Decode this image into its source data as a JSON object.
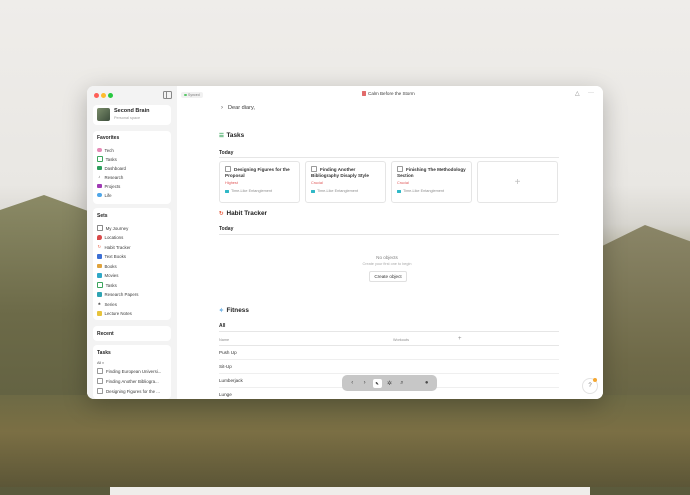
{
  "space": {
    "name": "Second Brain",
    "subtitle": "Personal space"
  },
  "favorites": {
    "title": "Favorites",
    "items": [
      {
        "label": "Tech",
        "icon": "tech-icon",
        "color": "#e58ab6"
      },
      {
        "label": "Tasks",
        "icon": "tasks-icon",
        "color": "#3ba55c"
      },
      {
        "label": "Dashboard",
        "icon": "dashboard-icon",
        "color": "#2d9d5b"
      },
      {
        "label": "Research",
        "icon": "research-icon",
        "color": "#4a4a4a"
      },
      {
        "label": "Projects",
        "icon": "projects-icon",
        "color": "#a03ab4"
      },
      {
        "label": "Life",
        "icon": "life-icon",
        "color": "#4fa6e8"
      }
    ]
  },
  "sets": {
    "title": "Sets",
    "items": [
      {
        "label": "My Journey",
        "icon": "journey-icon",
        "color": "#8a8a8a"
      },
      {
        "label": "Locations",
        "icon": "location-pin-icon",
        "color": "#d94a4a"
      },
      {
        "label": "Habit Tracker",
        "icon": "habit-tracker-icon",
        "color": "#e55a3c"
      },
      {
        "label": "Text Books",
        "icon": "text-books-icon",
        "color": "#3c6fd4"
      },
      {
        "label": "Books",
        "icon": "books-icon",
        "color": "#e0a33c"
      },
      {
        "label": "Movies",
        "icon": "movies-icon",
        "color": "#2fa8c7"
      },
      {
        "label": "Tasks",
        "icon": "tasks-icon",
        "color": "#3ba55c"
      },
      {
        "label": "Research Papers",
        "icon": "research-papers-icon",
        "color": "#2fa4b3"
      },
      {
        "label": "Series",
        "icon": "series-icon",
        "color": "#555555"
      },
      {
        "label": "Lecture Notes",
        "icon": "lecture-notes-icon",
        "color": "#e7c33c"
      }
    ]
  },
  "recent": {
    "title": "Recent"
  },
  "tasks_widget": {
    "title": "Tasks",
    "filter": "All",
    "items": [
      "Finding European Universi...",
      "Finding Another Bibliogra...",
      "Designing Figures for the ..."
    ]
  },
  "header": {
    "sync_status": "Synced",
    "document_title": "Calm Before the Storm"
  },
  "diary": {
    "text": "Dear diary,"
  },
  "tasks_block": {
    "title": "Tasks",
    "view": "Today",
    "cards": [
      {
        "title": "Designing Figures for the Proposal",
        "priority": "Highest",
        "tag": "Time-Like Entanglement"
      },
      {
        "title": "Finding Another Bibliography Disaply Style",
        "priority": "Crucial",
        "tag": "Time-Like Entanglement"
      },
      {
        "title": "Finishing The Methodology Section",
        "priority": "Crucial",
        "tag": "Time-Like Entanglement"
      }
    ]
  },
  "habit_block": {
    "title": "Habit Tracker",
    "view": "Today",
    "empty_title": "No objects",
    "empty_subtitle": "Create your first one to begin",
    "create_label": "Create object"
  },
  "fitness_block": {
    "title": "Fitness",
    "view": "All",
    "columns": [
      "Name",
      "Workouts"
    ],
    "rows": [
      "Push Up",
      "Sit-Up",
      "Lumberjack",
      "Lunge"
    ]
  },
  "colors": {
    "priority": "#e05555",
    "accent_green": "#5bc86a"
  }
}
